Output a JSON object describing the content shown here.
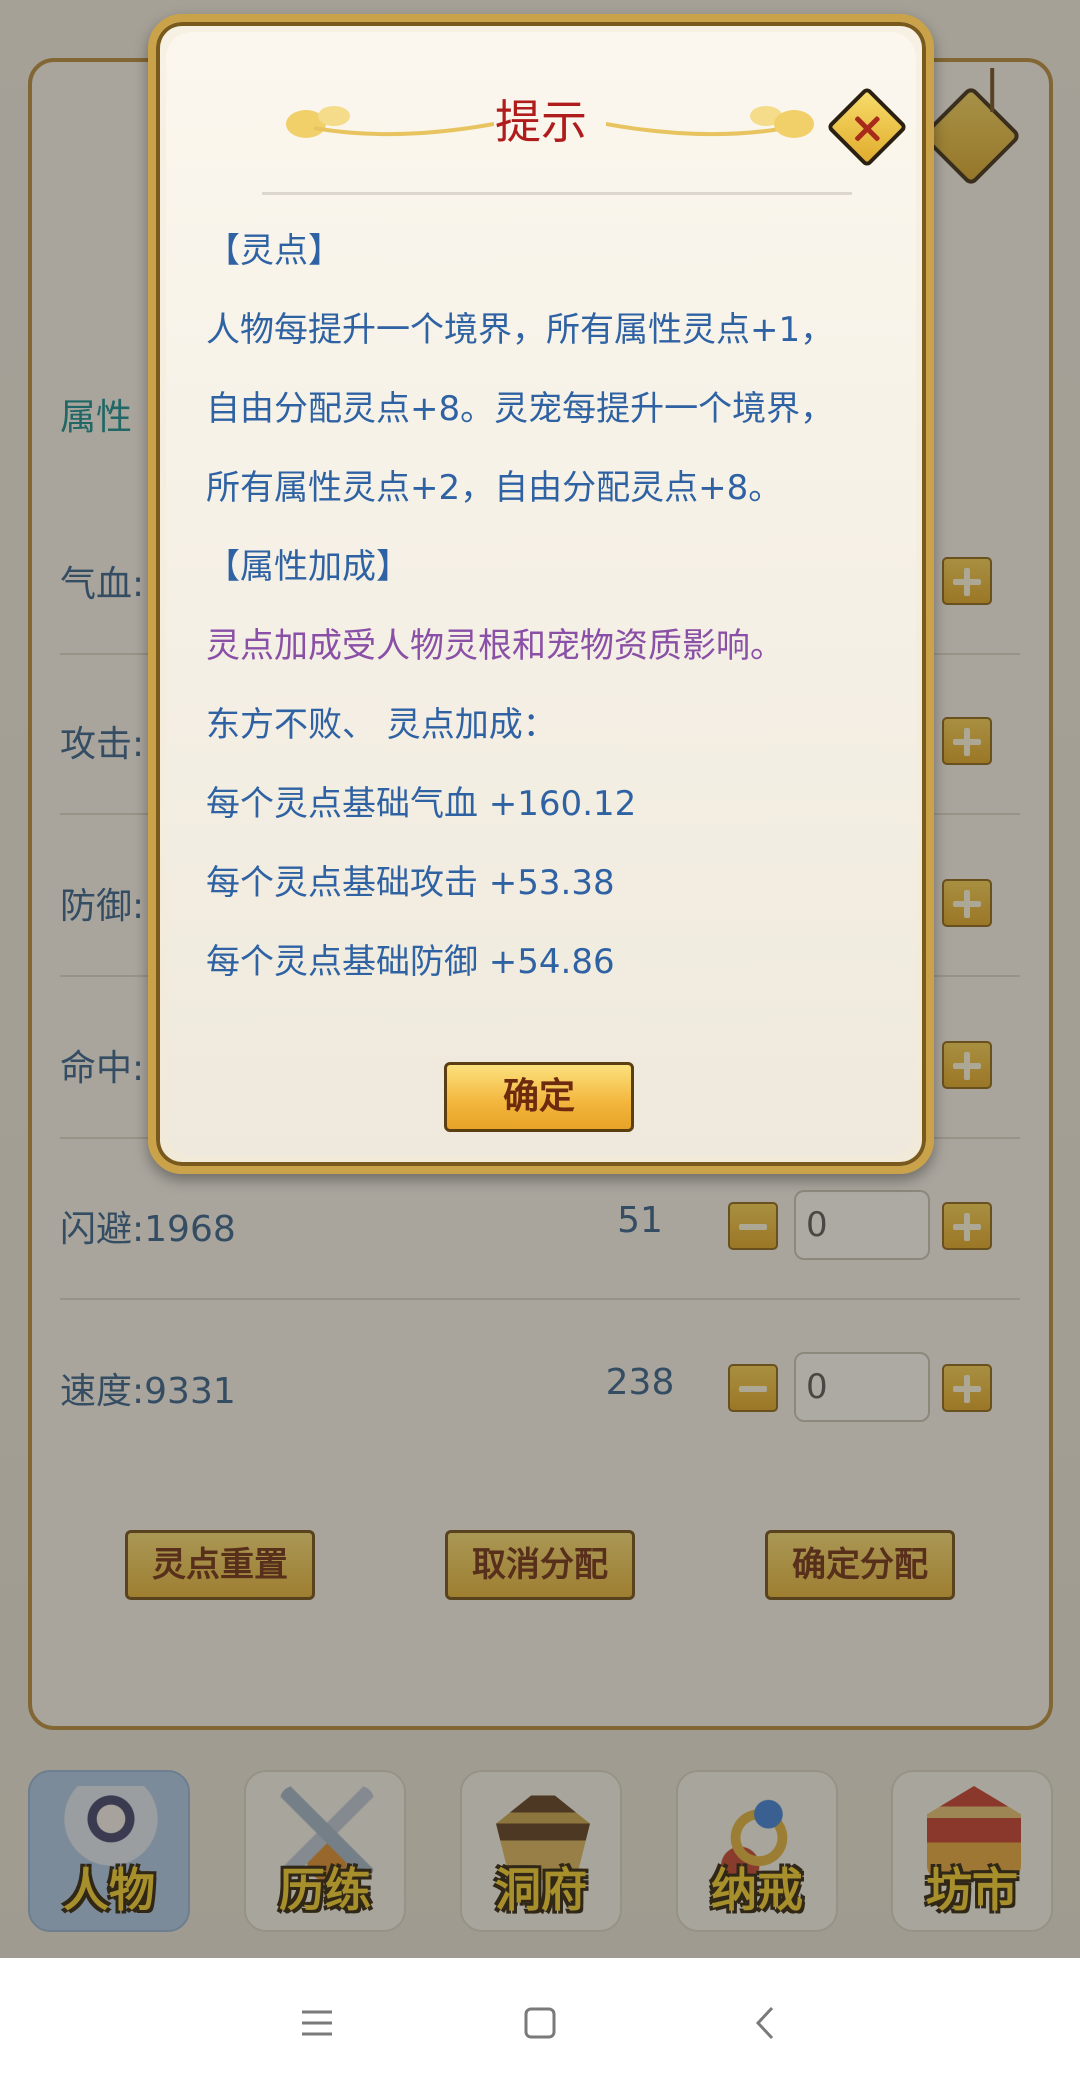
{
  "attributes": {
    "heading": "属性",
    "rows": [
      {
        "label": "气血:",
        "points": "",
        "input": ""
      },
      {
        "label": "攻击:",
        "points": "",
        "input": ""
      },
      {
        "label": "防御:",
        "points": "",
        "input": ""
      },
      {
        "label": "命中:",
        "points": "",
        "input": ""
      },
      {
        "label": "闪避:1968",
        "points": "51",
        "input": "0"
      },
      {
        "label": "速度:9331",
        "points": "238",
        "input": "0"
      }
    ],
    "buttons": {
      "reset": "灵点重置",
      "cancel": "取消分配",
      "confirm": "确定分配"
    }
  },
  "dialog": {
    "title": "提示",
    "lines": [
      "【灵点】",
      "人物每提升一个境界，所有属性灵点+1，",
      "自由分配灵点+8。灵宠每提升一个境界，",
      "所有属性灵点+2，自由分配灵点+8。",
      "【属性加成】",
      "灵点加成受人物灵根和宠物资质影响。",
      "东方不败、 灵点加成：",
      "每个灵点基础气血 +160.12",
      "每个灵点基础攻击 +53.38",
      "每个灵点基础防御 +54.86"
    ],
    "confirm": "确定"
  },
  "bottom_nav": [
    {
      "label": "人物",
      "active": true
    },
    {
      "label": "历练",
      "active": false
    },
    {
      "label": "洞府",
      "active": false
    },
    {
      "label": "纳戒",
      "active": false
    },
    {
      "label": "坊市",
      "active": false
    }
  ],
  "system_nav": [
    "menu-icon",
    "home-icon",
    "back-icon"
  ],
  "colors": {
    "accent_gold": "#e0a623",
    "title_red": "#b01c1c",
    "body_blue": "#2f62a3",
    "highlight_purple": "#8a4fa6",
    "attr_teal": "#0f8b8d"
  }
}
